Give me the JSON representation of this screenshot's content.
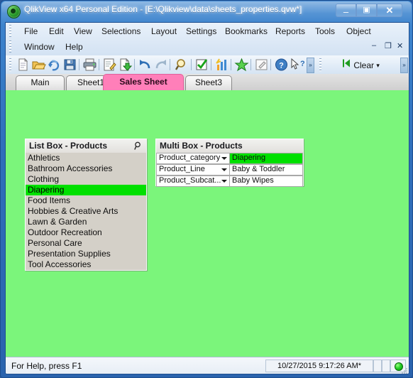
{
  "window": {
    "title": "QlikView x64 Personal Edition - [E:\\Qlikview\\data\\sheets_properties.qvw*]",
    "app_icon": "qlikview-logo-icon",
    "controls": {
      "minimize": "–",
      "maximize": "▣",
      "close": "✕"
    },
    "mdi_controls": {
      "minimize": "–",
      "restore": "❐",
      "close": "✕"
    }
  },
  "menubar": {
    "row1": [
      "File",
      "Edit",
      "View",
      "Selections",
      "Layout",
      "Settings",
      "Bookmarks",
      "Reports",
      "Tools",
      "Object"
    ],
    "row2": [
      "Window",
      "Help"
    ]
  },
  "toolbar": {
    "buttons": [
      {
        "name": "new-document-icon"
      },
      {
        "name": "open-document-icon"
      },
      {
        "name": "reload-icon"
      },
      {
        "name": "save-icon"
      },
      {
        "name": "print-icon"
      },
      {
        "name": "edit-script-icon"
      },
      {
        "name": "export-icon"
      },
      {
        "name": "undo-icon"
      },
      {
        "name": "redo-icon"
      },
      {
        "name": "search-icon"
      },
      {
        "name": "current-selections-icon"
      },
      {
        "name": "chart-wizard-icon"
      },
      {
        "name": "add-bookmark-icon"
      },
      {
        "name": "notes-icon"
      },
      {
        "name": "help-icon"
      },
      {
        "name": "context-help-icon"
      }
    ],
    "overflow_label": "»",
    "clear": {
      "label": "Clear",
      "icon": "clear-selections-icon",
      "dropdown": "▾"
    }
  },
  "tabs": [
    {
      "label": "Main",
      "active": false
    },
    {
      "label": "Sheet1",
      "active": false
    },
    {
      "label": "Sales Sheet",
      "active": true
    },
    {
      "label": "Sheet3",
      "active": false
    }
  ],
  "sheet": {
    "background_color": "#7bf57b",
    "listbox": {
      "title": "List Box - Products",
      "search_icon": "magnifier-icon",
      "items": [
        {
          "label": "Athletics",
          "selected": false
        },
        {
          "label": "Bathroom Accessories",
          "selected": false
        },
        {
          "label": "Clothing",
          "selected": false
        },
        {
          "label": "Diapering",
          "selected": true
        },
        {
          "label": "Food Items",
          "selected": false
        },
        {
          "label": "Hobbies & Creative Arts",
          "selected": false
        },
        {
          "label": "Lawn & Garden",
          "selected": false
        },
        {
          "label": "Outdoor Recreation",
          "selected": false
        },
        {
          "label": "Personal Care",
          "selected": false
        },
        {
          "label": "Presentation Supplies",
          "selected": false
        },
        {
          "label": "Tool Accessories",
          "selected": false
        }
      ]
    },
    "multibox": {
      "title": "Multi Box - Products",
      "rows": [
        {
          "field": "Product_category",
          "value": "Diapering",
          "selected": true
        },
        {
          "field": "Product_Line",
          "value": "Baby & Toddler",
          "selected": false
        },
        {
          "field": "Product_Subcat...",
          "value": "Baby Wipes",
          "selected": false
        }
      ]
    },
    "selection_color": "#00e000"
  },
  "statusbar": {
    "help_text": "For Help, press F1",
    "datetime": "10/27/2015 9:17:26 AM*",
    "led": "green-status-led"
  }
}
